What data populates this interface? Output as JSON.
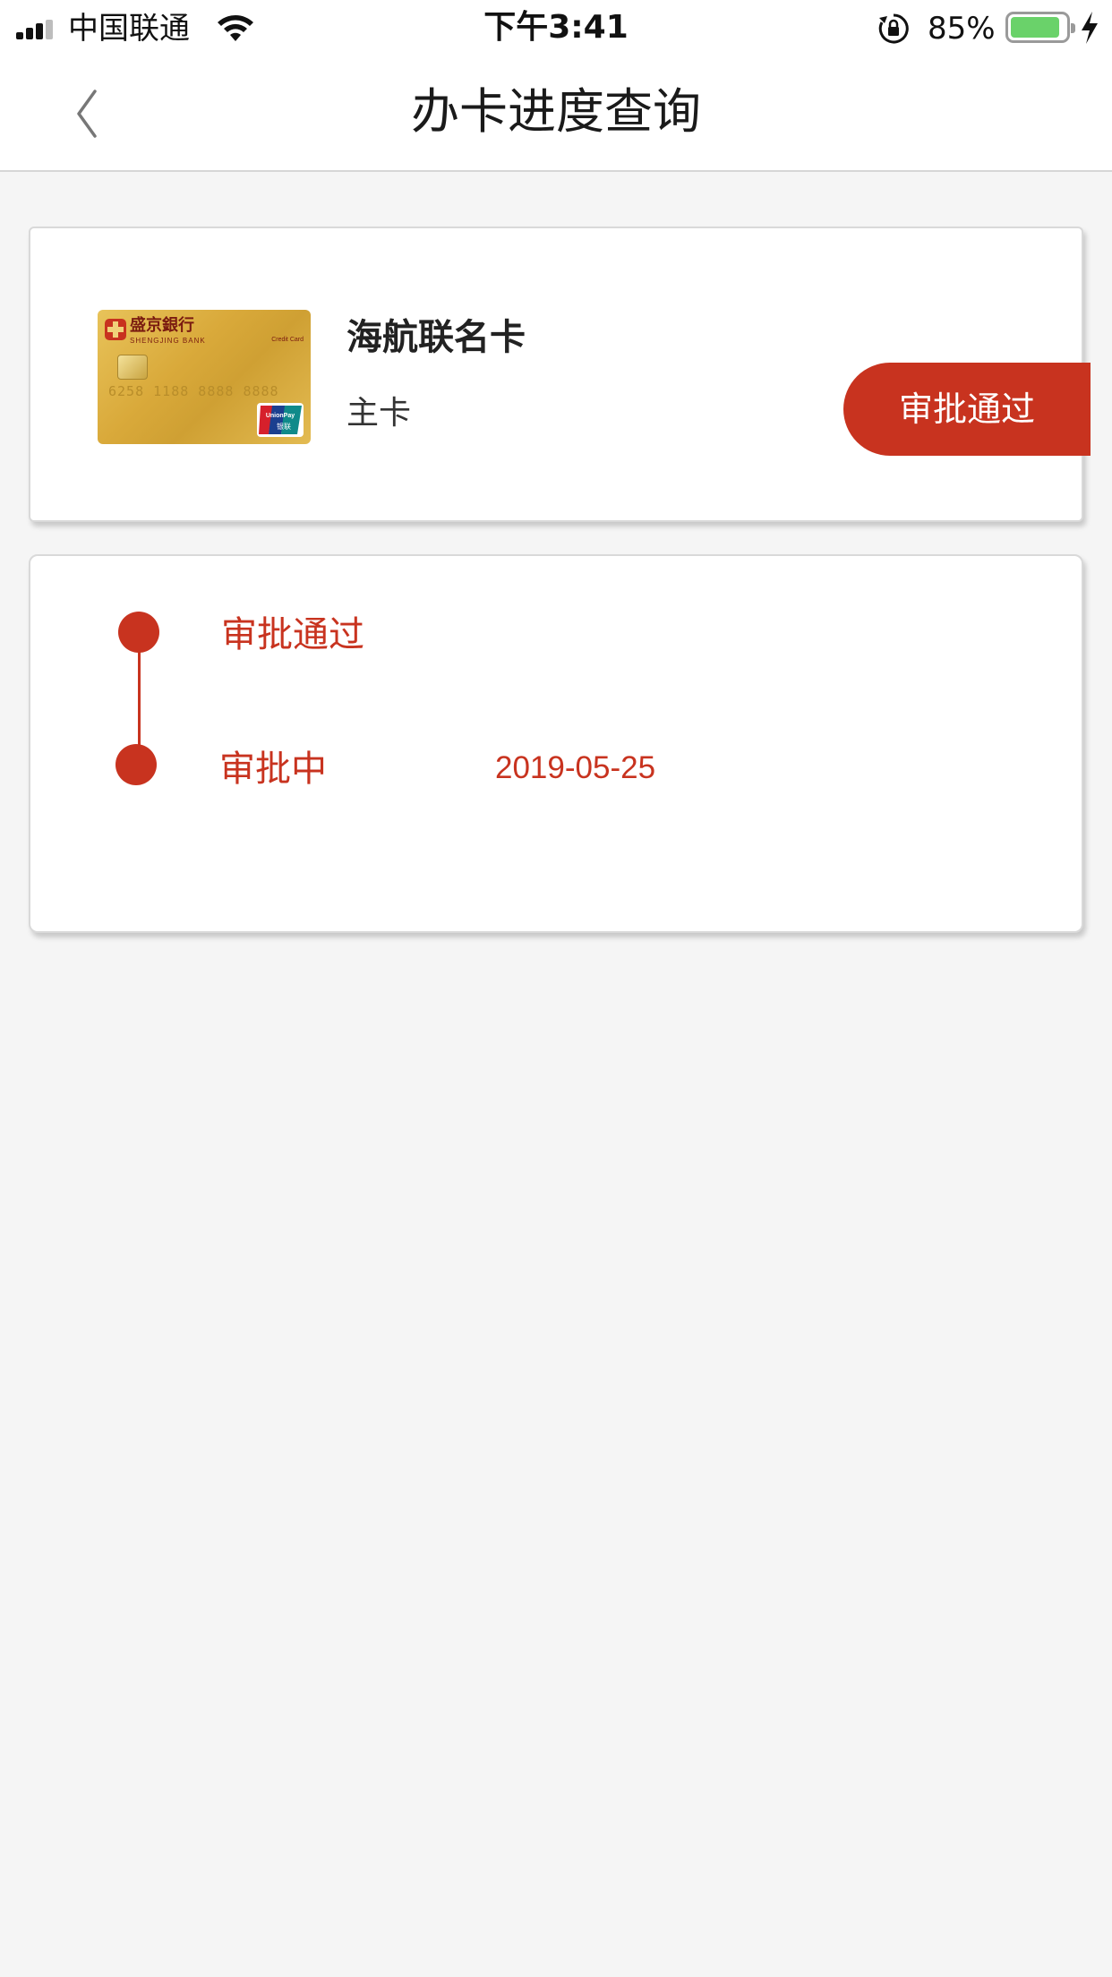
{
  "status_bar": {
    "carrier": "中国联通",
    "time": "下午3:41",
    "battery_percent": "85%",
    "battery_level": 0.85,
    "battery_color": "#6ad26a"
  },
  "nav": {
    "title": "办卡进度查询",
    "back_icon": "chevron-left-icon"
  },
  "card": {
    "name": "海航联名卡",
    "type": "主卡",
    "status": "审批通过",
    "image": {
      "bank_name": "盛京銀行",
      "bank_name_en": "SHENGJING BANK",
      "credit_label": "Credit Card",
      "number": "6258 1188 8888 8888",
      "network": "UnionPay 银联"
    }
  },
  "progress": {
    "steps": [
      {
        "label": "审批通过",
        "date": ""
      },
      {
        "label": "审批中",
        "date": "2019-05-25"
      }
    ]
  },
  "colors": {
    "accent": "#c8331f",
    "background": "#f5f5f5",
    "panel": "#ffffff"
  }
}
